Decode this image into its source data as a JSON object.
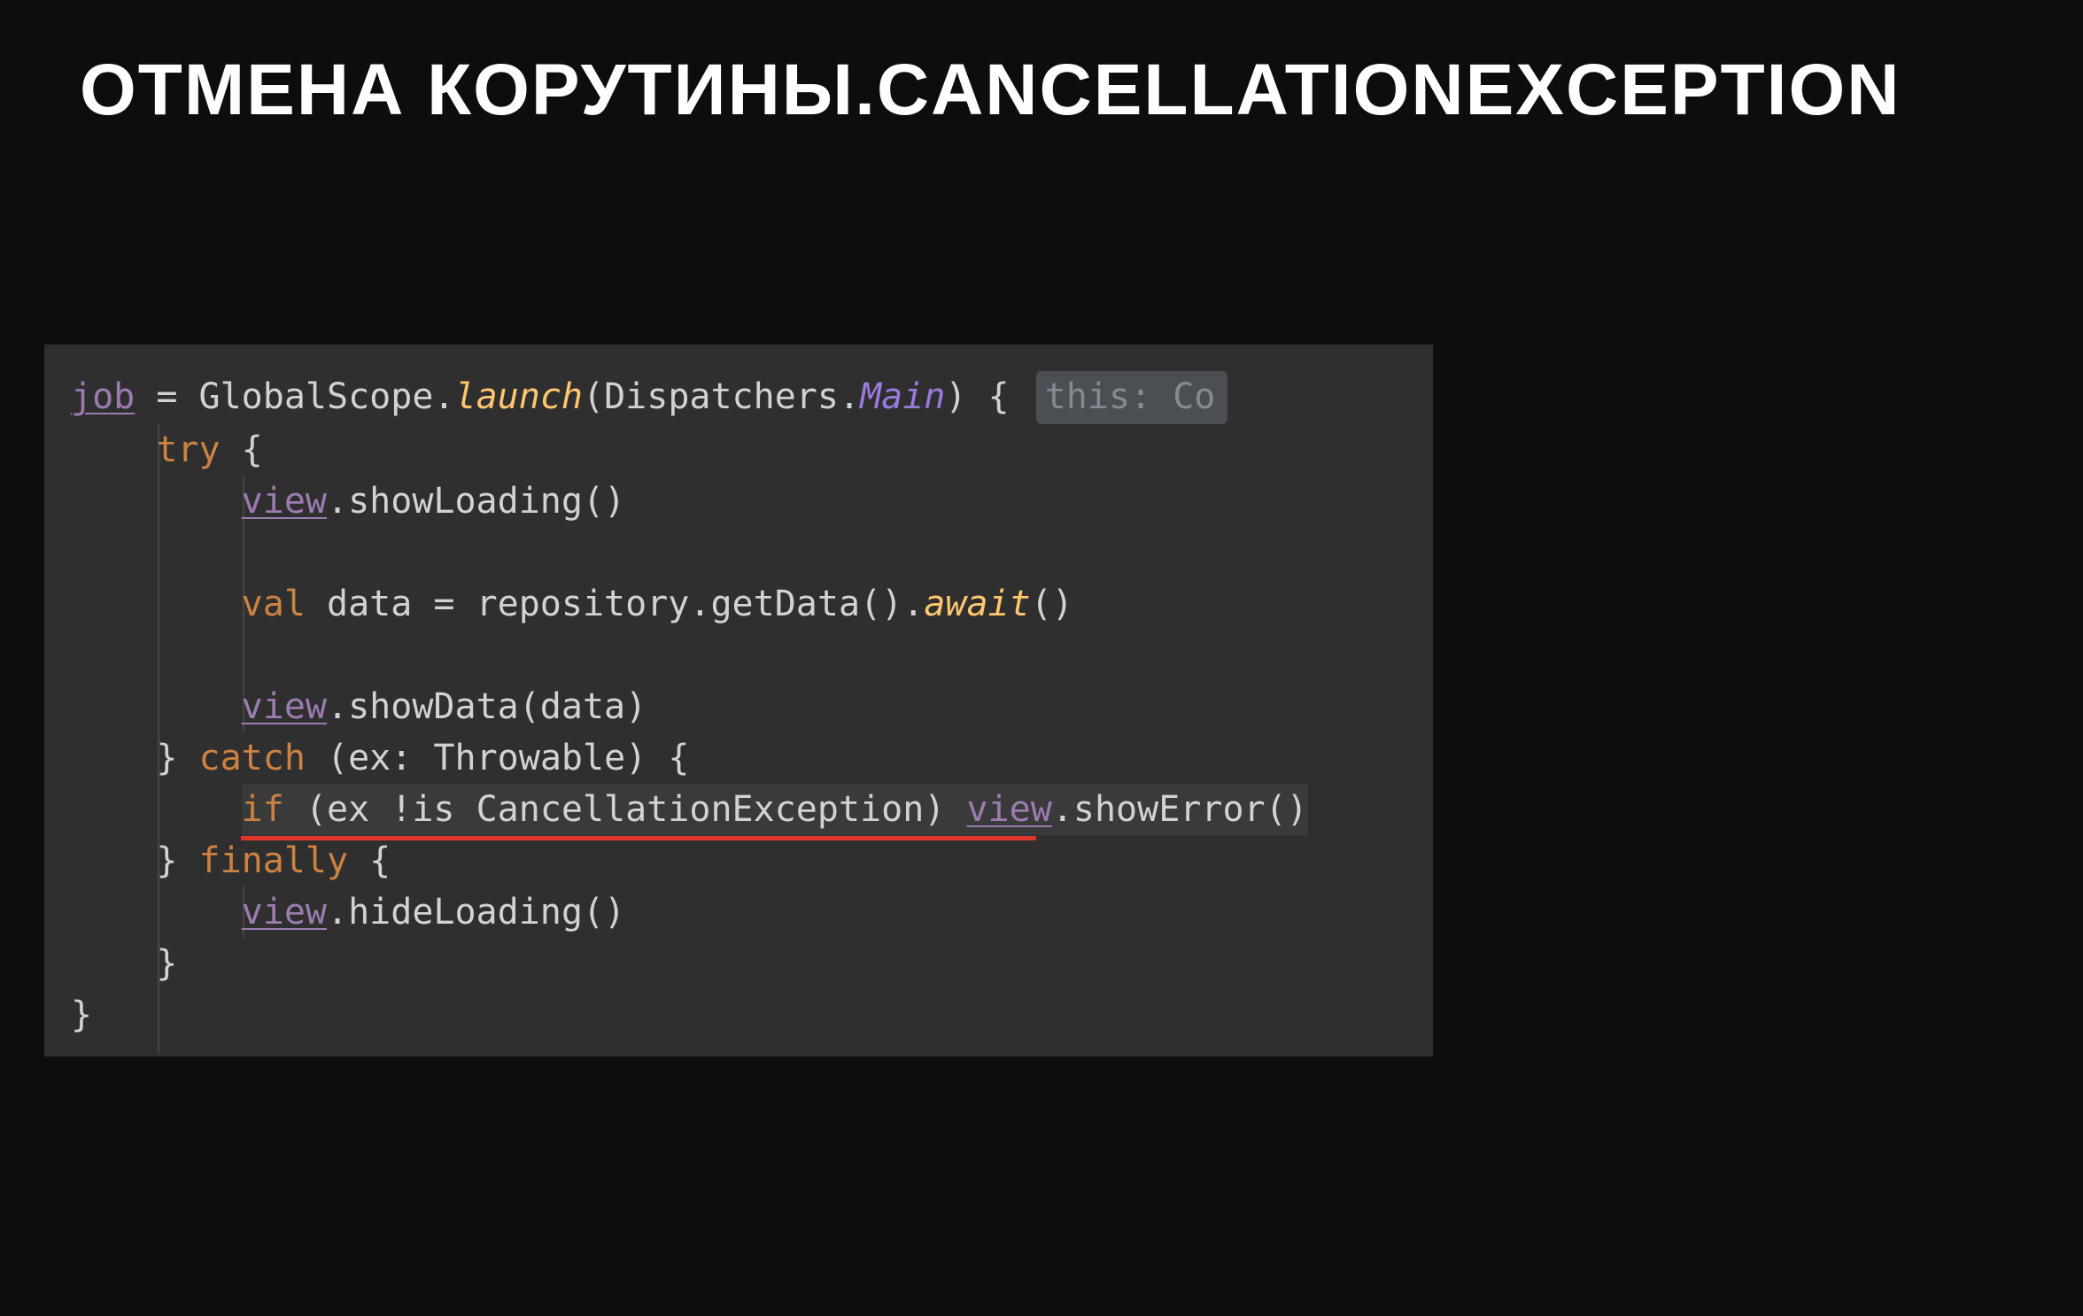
{
  "title": "ОТМЕНА КОРУТИНЫ.CANCELLATIONEXCEPTION",
  "hint": "this: Co",
  "code": {
    "l1_job": "job",
    "l1_a": " = GlobalScope.",
    "l1_launch": "launch",
    "l1_b": "(Dispatchers.",
    "l1_main": "Main",
    "l1_c": ") { ",
    "l2_try": "    try",
    "l2_brace": " {",
    "l3_pad": "        ",
    "l3_view": "view",
    "l3_rest": ".showLoading()",
    "l5_pad": "        ",
    "l5_val": "val",
    "l5_mid": " data = repository.getData().",
    "l5_await": "await",
    "l5_end": "()",
    "l7_pad": "        ",
    "l7_view": "view",
    "l7_rest": ".showData(data)",
    "l8_close": "    } ",
    "l8_catch": "catch",
    "l8_sig": " (ex: Throwable) {",
    "l9_pad": "        ",
    "l9_if": "if",
    "l9_cond": " (ex !is CancellationException) ",
    "l9_view": "view",
    "l9_rest": ".showError()",
    "l10_close": "    } ",
    "l10_finally": "finally",
    "l10_brace": " {",
    "l11_pad": "        ",
    "l11_view": "view",
    "l11_rest": ".hideLoading()",
    "l12": "    }",
    "l13": "}"
  }
}
